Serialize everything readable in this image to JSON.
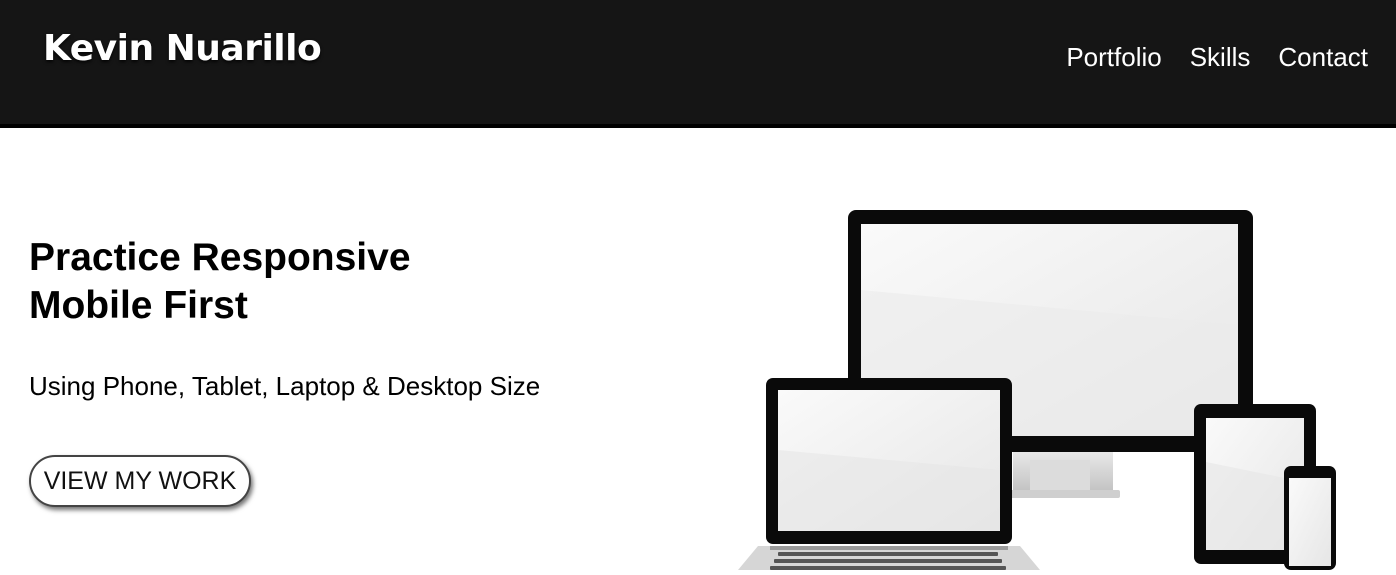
{
  "header": {
    "brand": "Kevin Nuarillo",
    "nav": [
      {
        "label": "Portfolio"
      },
      {
        "label": "Skills"
      },
      {
        "label": "Contact"
      }
    ]
  },
  "hero": {
    "title_line1": "Practice Responsive",
    "title_line2": "Mobile First",
    "subtitle": "Using Phone, Tablet, Laptop & Desktop Size",
    "cta_label": "VIEW MY WORK"
  },
  "image": {
    "icon": "responsive-devices-illustration"
  },
  "colors": {
    "header_bg": "#151515",
    "page_bg": "#ffffff",
    "text": "#000000"
  }
}
